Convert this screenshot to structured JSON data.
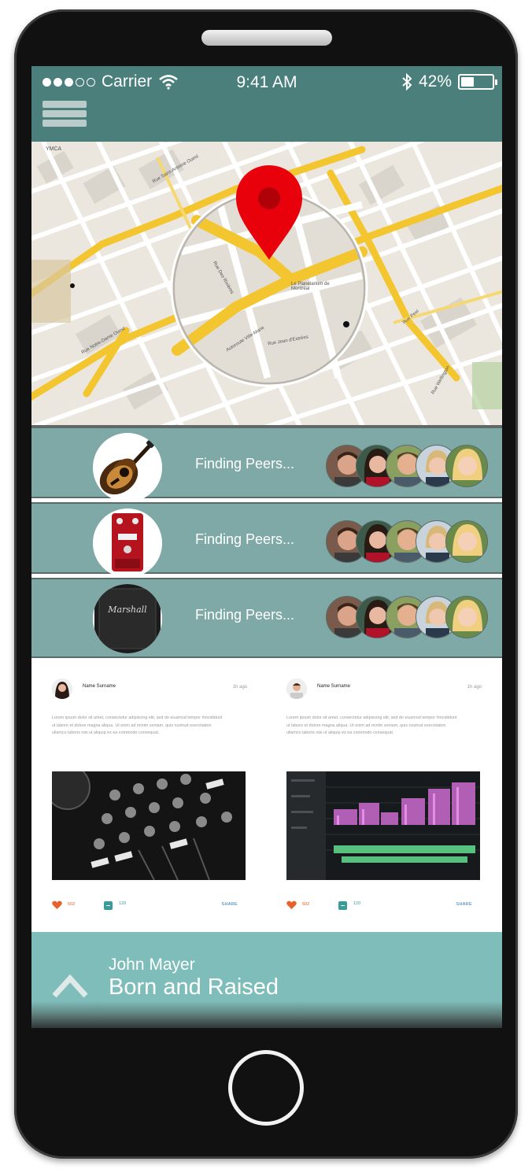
{
  "status_bar": {
    "carrier": "Carrier",
    "time": "9:41 AM",
    "battery_percent": "42%",
    "battery_level": 0.42,
    "signal_bars_filled": 3,
    "signal_bars_total": 5
  },
  "header": {
    "menu_icon": "hamburger-icon",
    "color": "#4a7f7c"
  },
  "map": {
    "pin_color": "#e8000b",
    "labels": [
      "YMCA",
      "Le Planetarium de Montréal",
      "Autoroute Ville-Marie",
      "Rue Jean d'Estrées",
      "Rue Des Rivières",
      "Rue Peel",
      "Rue Wellington",
      "Rue Notre-Dame Ouest",
      "Rue Saint-Antoine Ouest"
    ]
  },
  "peers": [
    {
      "product_icon": "acoustic-guitar",
      "status": "Finding Peers..."
    },
    {
      "product_icon": "guitar-pedal",
      "status": "Finding Peers..."
    },
    {
      "product_icon": "marshall-amp",
      "status": "Finding Peers..."
    }
  ],
  "feed": [
    {
      "user": "Name Surname",
      "time": "1h ago",
      "text": "Lorem ipsum dolor sit amet, consectetur adipiscing elit, sed do eiusmod tempor #incididunt ut labore et dolore magna aliqua. Ut enim ad minim veniam, quis nostrud exercitation ullamco laboris nisi ut aliquip ex ea commodo consequat.",
      "image": "dj-mixer",
      "likes": "502",
      "comments": "120",
      "share": "SHARE"
    },
    {
      "user": "Name Surname",
      "time": "1h ago",
      "text": "Lorem ipsum dolor sit amet, consectetur adipiscing elit, sed do eiusmod tempor #incididunt ut labore et dolore magna aliqua. Ut enim ad minim veniam, quis nostrud exercitation ullamco laboris nisi ut aliquip ex ea commodo consequat.",
      "image": "audio-waveform-editor",
      "likes": "502",
      "comments": "120",
      "share": "SHARE"
    }
  ],
  "now_playing": {
    "artist": "John Mayer",
    "album": "Born and Raised",
    "expand_icon": "chevron-up-icon"
  }
}
